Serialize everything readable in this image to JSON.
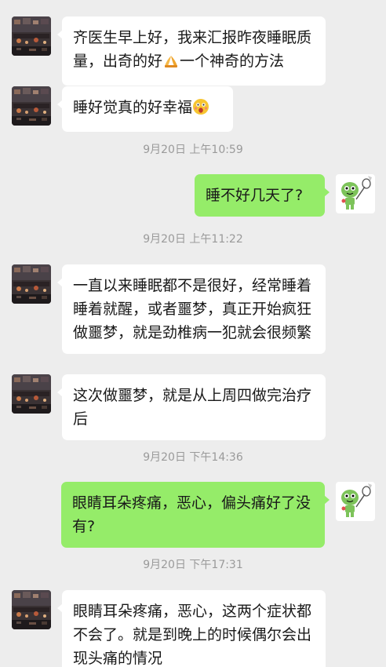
{
  "messages": [
    {
      "side": "in",
      "text_a": "齐医生早上好，我来汇报昨夜睡眠质量，出奇的好",
      "emoji_a": "pray-hands-emoji",
      "text_b": "一个神奇的方法"
    },
    {
      "side": "in",
      "text": "睡好觉真的好幸福",
      "emoji": "surprised-face-emoji"
    },
    {
      "timestamp": "9月20日 上午10:59"
    },
    {
      "side": "out",
      "text": "睡不好几天了?"
    },
    {
      "timestamp": "9月20日 上午11:22"
    },
    {
      "side": "in",
      "text": "一直以来睡眠都不是很好，经常睡着睡着就醒，或者噩梦，真正开始疯狂做噩梦，就是劲椎病一犯就会很频繁"
    },
    {
      "side": "in",
      "text": "这次做噩梦，就是从上周四做完治疗后"
    },
    {
      "timestamp": "9月20日 下午14:36"
    },
    {
      "side": "out",
      "text": "眼睛耳朵疼痛，恶心，偏头痛好了没有?"
    },
    {
      "timestamp": "9月20日 下午17:31"
    },
    {
      "side": "in",
      "text": "眼睛耳朵疼痛，恶心，这两个症状都不会了。就是到晚上的时候偶尔会出现头痛的情况"
    }
  ],
  "colors": {
    "background": "#ededed",
    "incoming_bubble": "#ffffff",
    "outgoing_bubble": "#95ec69",
    "timestamp_text": "#9a9a9a",
    "message_text": "#191919"
  },
  "icons": {
    "contact_avatar": "night-scene-avatar",
    "self_avatar": "cartoon-badminton-avatar"
  }
}
